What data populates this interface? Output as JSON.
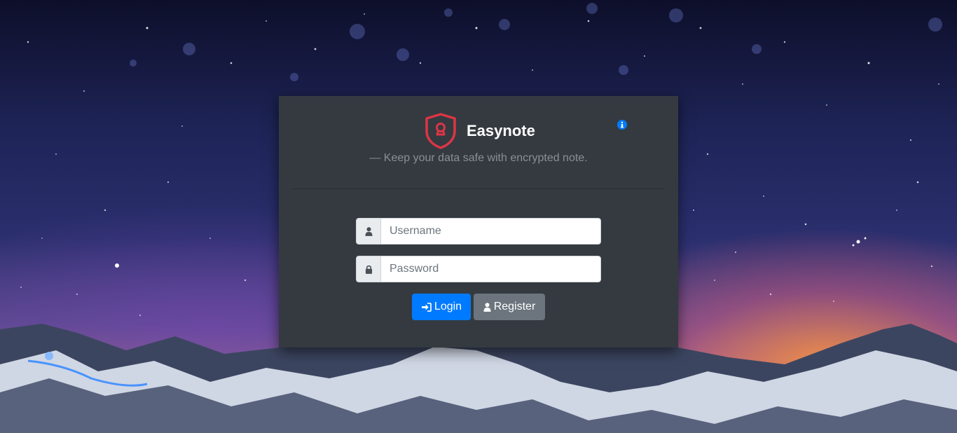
{
  "app": {
    "title": "Easynote",
    "tagline": "— Keep your data safe with encrypted note."
  },
  "form": {
    "username": {
      "placeholder": "Username",
      "value": "",
      "icon": "user-icon"
    },
    "password": {
      "placeholder": "Password",
      "value": "",
      "icon": "lock-icon"
    }
  },
  "buttons": {
    "login": {
      "label": "Login",
      "icon": "sign-in-icon"
    },
    "register": {
      "label": "Register",
      "icon": "user-icon"
    }
  },
  "icons": {
    "logo": "shield-keyhole-icon",
    "info": "info-circle-icon"
  },
  "colors": {
    "card": "#343a40",
    "primary": "#007bff",
    "secondary": "#6c757d",
    "logo": "#dc3545",
    "info": "#007bff"
  }
}
